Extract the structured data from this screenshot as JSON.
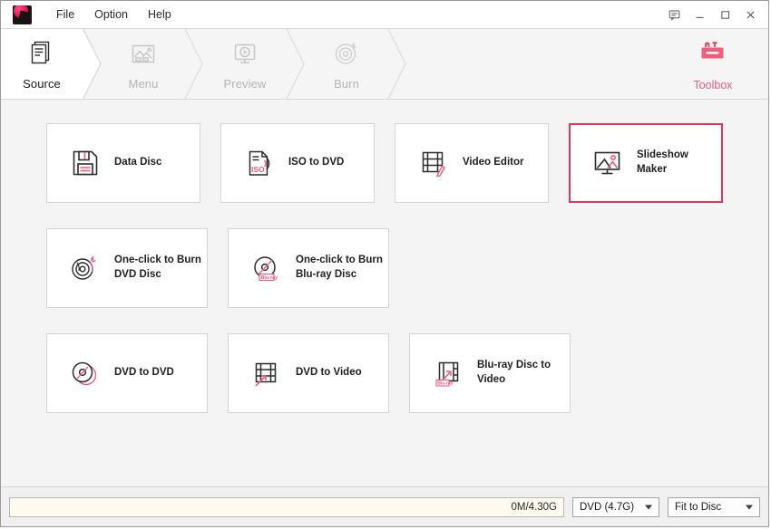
{
  "titlebar": {
    "menus": [
      {
        "label": "File",
        "name": "menu-file"
      },
      {
        "label": "Option",
        "name": "menu-option"
      },
      {
        "label": "Help",
        "name": "menu-help"
      }
    ],
    "controls": {
      "feedback": "feedback-icon",
      "minimize": "minimize-button",
      "maximize": "maximize-button",
      "close": "close-button"
    },
    "logo_name": "app-logo"
  },
  "steps": [
    {
      "label": "Source",
      "icon": "document-stack-icon",
      "active": true
    },
    {
      "label": "Menu",
      "icon": "image-menu-icon",
      "active": false
    },
    {
      "label": "Preview",
      "icon": "play-monitor-icon",
      "active": false
    },
    {
      "label": "Burn",
      "icon": "burning-disc-icon",
      "active": false
    }
  ],
  "toolbox": {
    "label": "Toolbox",
    "icon": "toolbox-icon",
    "color": "#e8607e"
  },
  "tools": {
    "rows": [
      [
        {
          "label": "Data Disc",
          "icon": "floppy-disk-icon",
          "selected": false
        },
        {
          "label": "ISO to DVD",
          "icon": "iso-file-icon",
          "selected": false
        },
        {
          "label": "Video Editor",
          "icon": "film-pencil-icon",
          "selected": false
        },
        {
          "label": "Slideshow Maker",
          "icon": "monitor-photo-icon",
          "selected": true
        }
      ],
      [
        {
          "label": "One-click to Burn\nDVD Disc",
          "icon": "burn-dvd-icon",
          "selected": false
        },
        {
          "label": "One-click to Burn\nBlu-ray Disc",
          "icon": "burn-bluray-icon",
          "selected": false
        }
      ],
      [
        {
          "label": "DVD to DVD",
          "icon": "disc-copy-icon",
          "selected": false
        },
        {
          "label": "DVD to Video",
          "icon": "film-arrow-icon",
          "selected": false
        },
        {
          "label": "Blu-ray Disc to\nVideo",
          "icon": "bluray-film-icon",
          "selected": false
        }
      ]
    ]
  },
  "statusbar": {
    "capacity_text": "0M/4.30G",
    "disc_type": "DVD (4.7G)",
    "fit_mode": "Fit to Disc"
  },
  "colors": {
    "accent": "#e0365c",
    "accent_soft": "#e8607e",
    "content_bg": "#f4f4f4",
    "capacity_bg": "#fdfbf0"
  }
}
